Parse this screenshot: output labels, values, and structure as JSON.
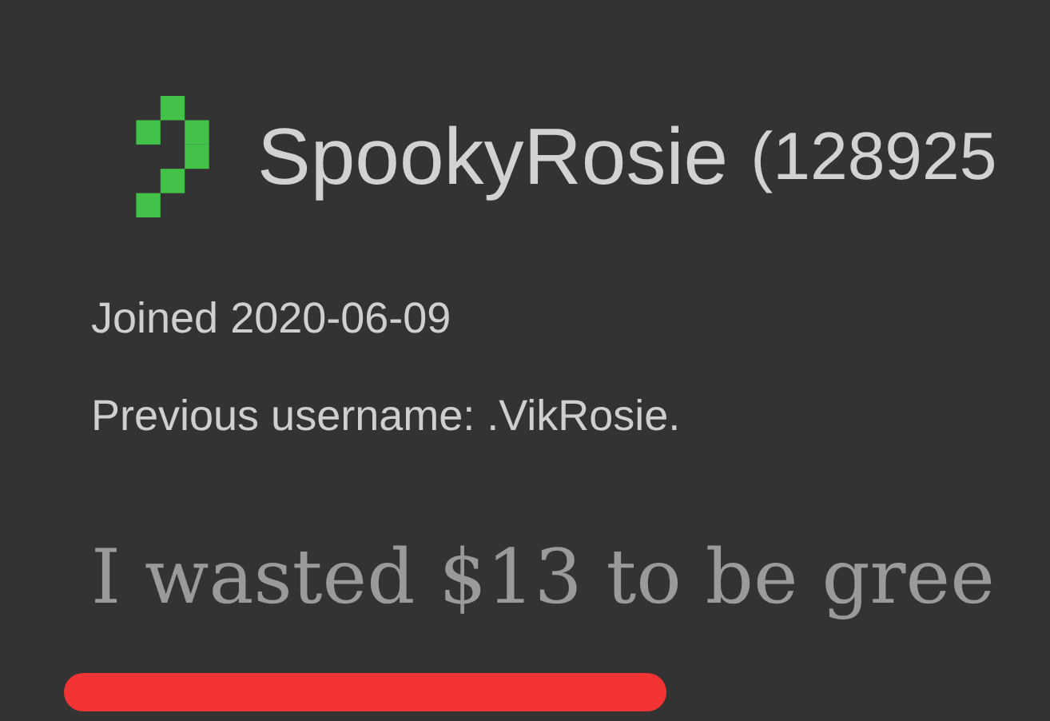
{
  "profile": {
    "username": "SpookyRosie",
    "user_id": "(128925",
    "joined": "Joined 2020-06-09",
    "previous_username": "Previous username: .VikRosie."
  },
  "post": {
    "text": "I wasted $13 to be gree"
  }
}
